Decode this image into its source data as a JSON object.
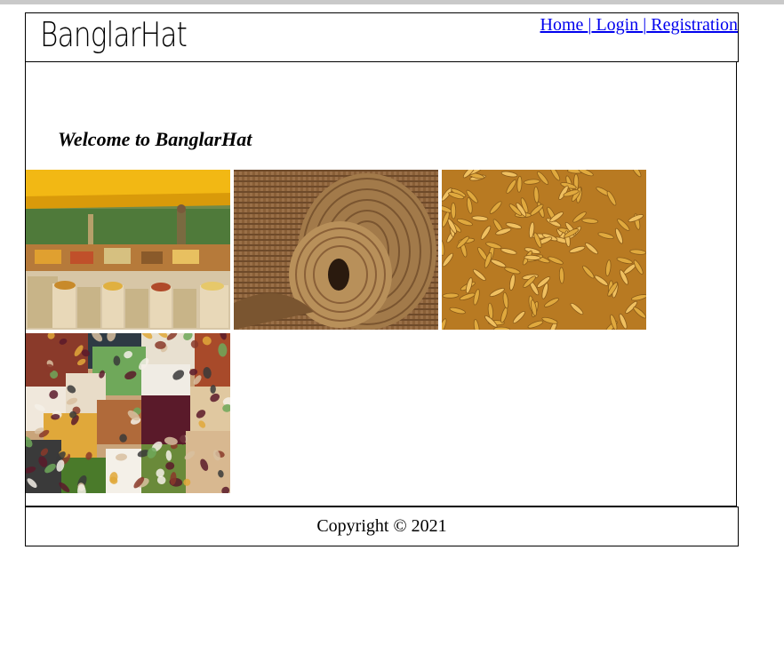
{
  "header": {
    "logo_text": "BanglarHat",
    "nav": {
      "home": "Home ",
      "sep1": "|",
      "login": " Login ",
      "sep2": "|",
      "registration": " Registration"
    }
  },
  "main": {
    "welcome": "Welcome to BanglarHat",
    "images": [
      {
        "name": "market-stall-image",
        "icon": "market-photo"
      },
      {
        "name": "jute-spool-image",
        "icon": "jute-photo"
      },
      {
        "name": "rice-grains-image",
        "icon": "paddy-photo"
      },
      {
        "name": "beans-lentils-image",
        "icon": "beans-photo"
      }
    ]
  },
  "footer": {
    "copyright": "Copyright © 2021"
  },
  "colors": {
    "link": "#0000ee",
    "border": "#000000",
    "tarp": "#f2b814",
    "jute": "#a27a4a",
    "paddy": "#c8912c"
  }
}
